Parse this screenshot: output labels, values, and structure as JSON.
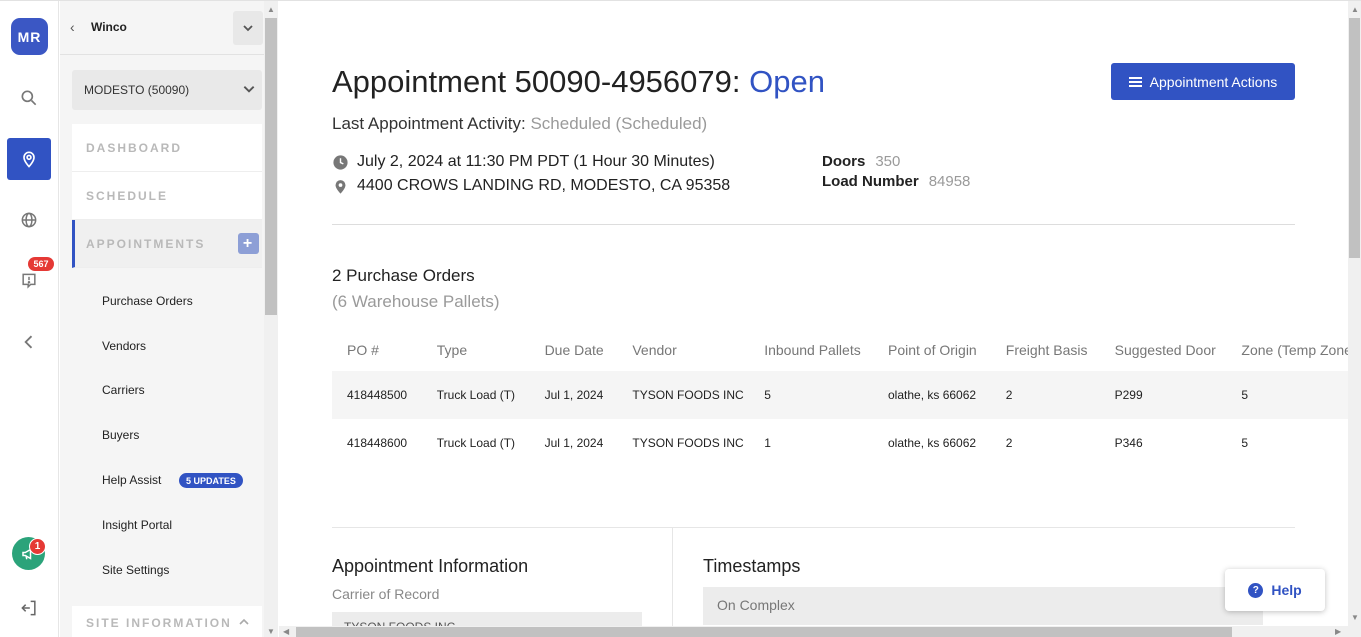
{
  "rail": {
    "avatar_initials": "MR",
    "notifications_count": "567",
    "announcements_count": "1",
    "icons": [
      "search-icon",
      "location-pin-icon",
      "globe-icon",
      "alert-icon",
      "collapse-left-icon",
      "megaphone-icon",
      "logout-icon"
    ],
    "accent_color": "#3153c3"
  },
  "sidenav": {
    "org_name": "Winco",
    "site_selected": "MODESTO (50090)",
    "sections": {
      "dashboard": "DASHBOARD",
      "schedule": "SCHEDULE",
      "appointments": "APPOINTMENTS",
      "site_information": "SITE INFORMATION"
    },
    "items": [
      {
        "label": "Purchase Orders"
      },
      {
        "label": "Vendors"
      },
      {
        "label": "Carriers"
      },
      {
        "label": "Buyers"
      },
      {
        "label": "Help Assist"
      },
      {
        "label": "Insight Portal"
      },
      {
        "label": "Site Settings"
      }
    ],
    "help_assist_badge": "5 UPDATES",
    "add_symbol": "+"
  },
  "appointment": {
    "title": "Appointment 50090-4956079:",
    "status": "Open",
    "actions_label": "Appointment Actions",
    "last_activity_label": "Last Appointment Activity:",
    "last_activity_value": "Scheduled (Scheduled)",
    "datetime": "July 2, 2024 at 11:30 PM PDT (1 Hour 30 Minutes)",
    "address": "4400 CROWS LANDING RD, MODESTO, CA 95358",
    "doors_label": "Doors",
    "doors_value": "350",
    "load_number_label": "Load Number",
    "load_number_value": "84958"
  },
  "purchase_orders": {
    "count_text": "2 Purchase Orders",
    "pallets_text": "(6 Warehouse Pallets)",
    "columns": [
      "PO #",
      "Type",
      "Due Date",
      "Vendor",
      "Inbound Pallets",
      "Point of Origin",
      "Freight Basis",
      "Suggested Door",
      "Zone (Temp Zone"
    ],
    "rows": [
      [
        "418448500",
        "Truck Load (T)",
        "Jul 1, 2024",
        "TYSON FOODS INC",
        "5",
        "olathe, ks 66062",
        "2",
        "P299",
        "5"
      ],
      [
        "418448600",
        "Truck Load (T)",
        "Jul 1, 2024",
        "TYSON FOODS INC",
        "1",
        "olathe, ks 66062",
        "2",
        "P346",
        "5"
      ]
    ]
  },
  "info": {
    "appointment_information_title": "Appointment Information",
    "carrier_of_record_label": "Carrier of Record",
    "carrier_of_record_value": "TYSON FOODS INC",
    "timestamps_title": "Timestamps",
    "on_complex_label": "On Complex"
  },
  "help": {
    "label": "Help",
    "icon_symbol": "?"
  }
}
